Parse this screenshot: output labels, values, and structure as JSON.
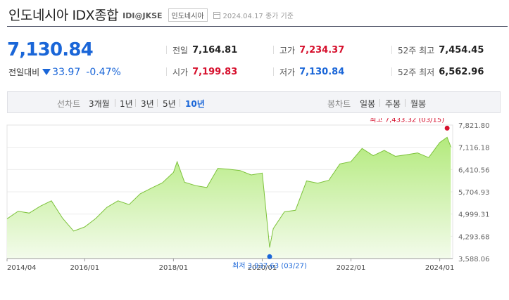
{
  "header": {
    "title": "인도네시아 IDX종합",
    "ticker": "IDI@JKSE",
    "market_badge": "인도네시아",
    "date_info": "2024.04.17 종가 기준"
  },
  "quote": {
    "price": "7,130.84",
    "change_label": "전일대비",
    "change_value": "33.97",
    "change_pct": "-0.47%",
    "direction_color": "#1a66d8",
    "up_color": "#d6102d"
  },
  "stats": {
    "prev_close": {
      "label": "전일",
      "value": "7,164.81"
    },
    "open": {
      "label": "시가",
      "value": "7,199.83"
    },
    "high": {
      "label": "고가",
      "value": "7,234.37"
    },
    "low": {
      "label": "저가",
      "value": "7,130.84"
    },
    "high_52w": {
      "label": "52주 최고",
      "value": "7,454.45"
    },
    "low_52w": {
      "label": "52주 최저",
      "value": "6,562.96"
    }
  },
  "toolbar": {
    "line_label": "선차트",
    "periods": [
      "3개월",
      "1년",
      "3년",
      "5년",
      "10년"
    ],
    "active_period": "10년",
    "candle_label": "봉차트",
    "candles": [
      "일봉",
      "주봉",
      "월봉"
    ]
  },
  "chart_data": {
    "type": "area",
    "x": [
      "2014/04",
      "2014/07",
      "2014/10",
      "2015/01",
      "2015/04",
      "2015/07",
      "2015/10",
      "2016/01",
      "2016/04",
      "2016/07",
      "2016/10",
      "2017/01",
      "2017/04",
      "2017/07",
      "2017/10",
      "2018/01",
      "2018/02",
      "2018/04",
      "2018/07",
      "2018/10",
      "2019/01",
      "2019/04",
      "2019/07",
      "2019/10",
      "2020/01",
      "2020/03",
      "2020/04",
      "2020/07",
      "2020/10",
      "2021/01",
      "2021/04",
      "2021/07",
      "2021/10",
      "2022/01",
      "2022/04",
      "2022/07",
      "2022/10",
      "2023/01",
      "2023/04",
      "2023/07",
      "2023/10",
      "2024/01",
      "2024/03",
      "2024/04"
    ],
    "values": [
      4850,
      5090,
      5030,
      5250,
      5420,
      4870,
      4460,
      4590,
      4860,
      5210,
      5420,
      5300,
      5640,
      5820,
      5990,
      6320,
      6660,
      6010,
      5900,
      5840,
      6450,
      6420,
      6380,
      6240,
      6300,
      3937.63,
      4540,
      5070,
      5120,
      6050,
      5980,
      6070,
      6590,
      6660,
      7080,
      6850,
      7020,
      6830,
      6880,
      6940,
      6790,
      7270,
      7433.32,
      7130.84
    ],
    "ylim": [
      3588.06,
      7821.8
    ],
    "y_ticks": [
      "7,821.80",
      "7,116.18",
      "6,410.56",
      "5,704.93",
      "4,999.31",
      "4,293.68",
      "3,588.06"
    ],
    "y_tick_values": [
      7821.8,
      7116.18,
      6410.56,
      5704.93,
      4999.31,
      4293.68,
      3588.06
    ],
    "x_ticks": [
      "2014/04",
      "2016/01",
      "2018/01",
      "2020/01",
      "2022/01",
      "2024/01"
    ],
    "high_annotation": {
      "text": "최고 7,433.32 (03/15)",
      "value": 7433.32,
      "x": "2024/03",
      "color": "#d6102d"
    },
    "low_annotation": {
      "text": "최저 3,937.63 (03/27)",
      "value": 3937.63,
      "x": "2020/03",
      "color": "#1a66d8"
    },
    "fill_color_top": "#b3ea7c",
    "fill_color_bottom": "#f3fbeb",
    "line_color": "#7cc23a",
    "grid": true
  }
}
